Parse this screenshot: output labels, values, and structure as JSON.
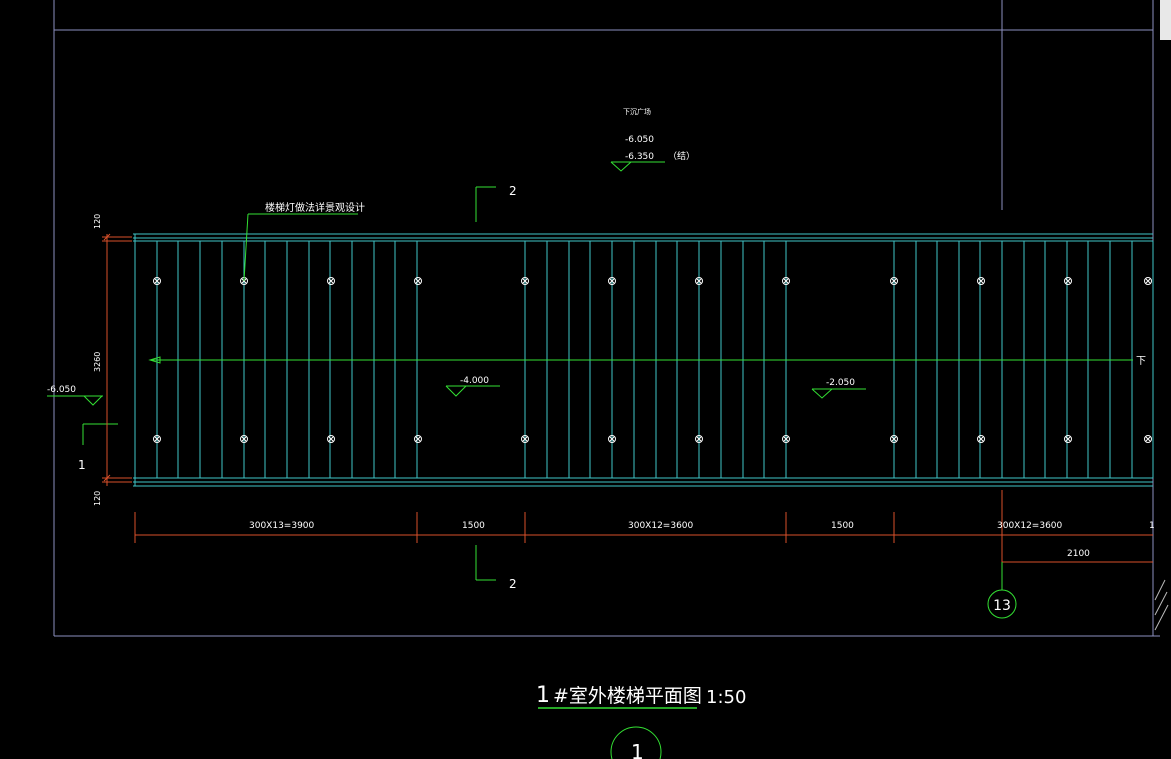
{
  "annotations": {
    "area_label": "下沉广场",
    "elev_top1": "-6.050",
    "elev_top2": "-6.350",
    "elev_top2_note": "（结）",
    "railing_note": "楼梯灯做法详景观设计",
    "landing_left_elev": "-4.000",
    "landing_right_elev": "-2.050",
    "left_side_elev": "-6.050",
    "down_arrow": "下"
  },
  "section_marks": {
    "section_top": "2",
    "section_bottom": "2",
    "section_left": "1"
  },
  "dimensions": {
    "left_top_width": "120",
    "left_height": "3260",
    "left_bottom_width": "120",
    "span1": "300X13=3900",
    "span2": "1500",
    "span3": "300X12=3600",
    "span4": "1500",
    "span5": "300X12=3600",
    "span_tail": "1",
    "sub_span": "2100"
  },
  "grid_axis": {
    "label": "13"
  },
  "title_block": {
    "title_number": "1",
    "title_text": "#室外楼梯平面图",
    "scale": "1:50",
    "view_number": "1"
  },
  "colors": {
    "background": "#000000",
    "frame": "#8c8fbf",
    "tread": "#3fc6c8",
    "green": "#33e033",
    "white": "#ffffff",
    "dimension": "#d9502a"
  }
}
